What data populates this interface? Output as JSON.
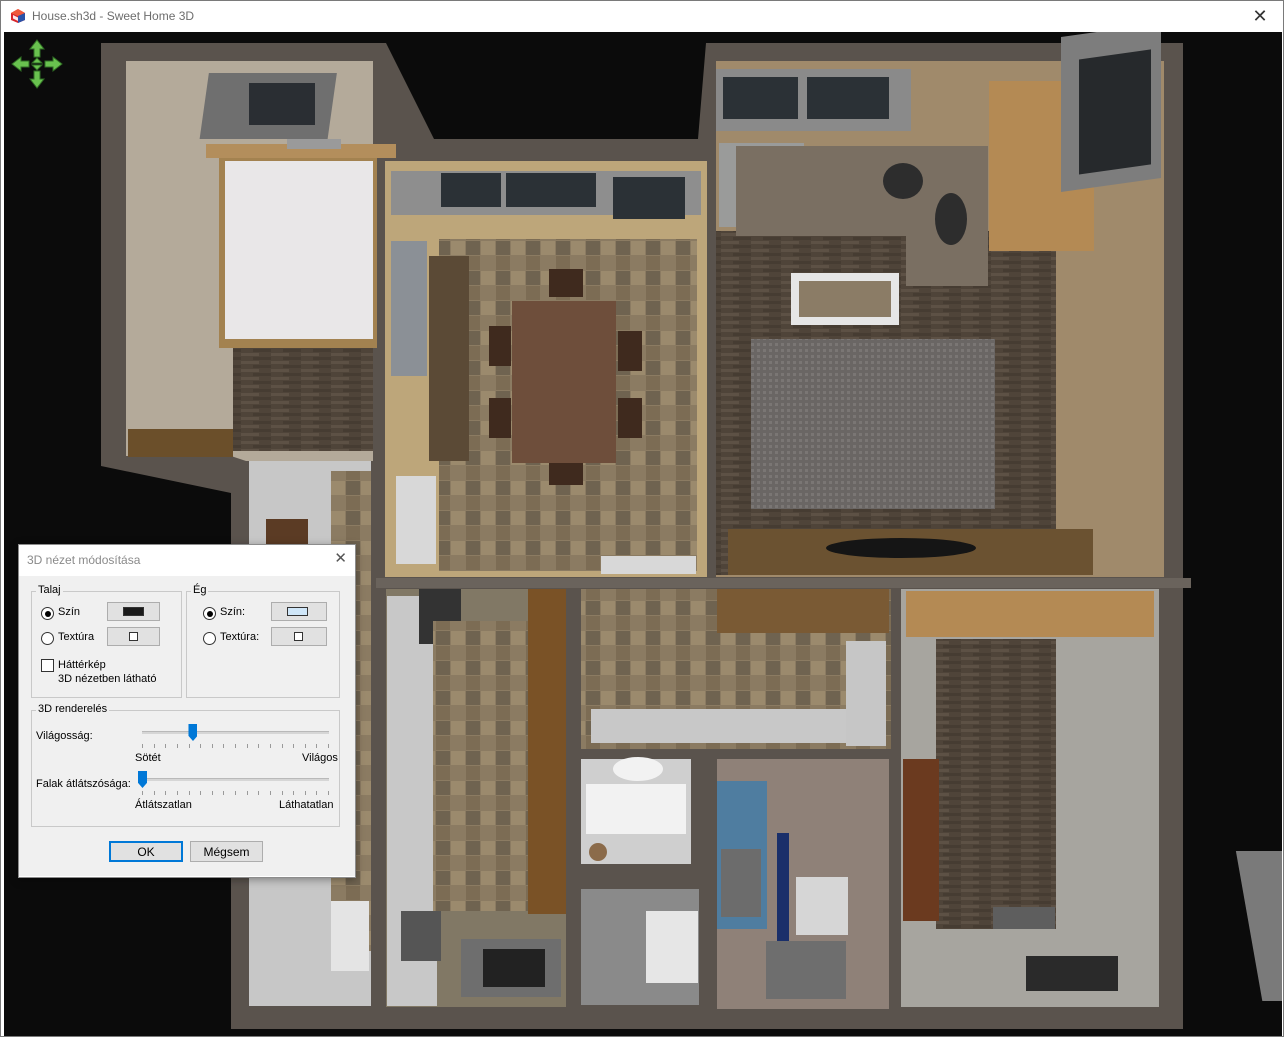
{
  "window": {
    "title": "House.sh3d - Sweet Home 3D",
    "close_glyph": "✕"
  },
  "icons": {
    "app": "sweet-home-3d-app-icon",
    "navigator": "navigation-arrows-icon"
  },
  "dialog": {
    "title": "3D nézet módosítása",
    "close_glyph": "✕",
    "ground": {
      "label": "Talaj",
      "color_label": "Szín",
      "texture_label": "Textúra",
      "color": "#1a1a1a",
      "selected": "color",
      "bg_checkbox_label": "Háttérkép",
      "bg_checkbox_sublabel": "3D nézetben látható",
      "bg_checked": false
    },
    "sky": {
      "label": "Ég",
      "color_label": "Szín:",
      "texture_label": "Textúra:",
      "color": "#cfe6f8",
      "selected": "color"
    },
    "rendering": {
      "label": "3D renderelés",
      "brightness_label": "Világosság:",
      "brightness_min_label": "Sötét",
      "brightness_max_label": "Világos",
      "brightness_value": 0.27,
      "transparency_label": "Falak átlátszósága:",
      "transparency_min_label": "Átlátszatlan",
      "transparency_max_label": "Láthatatlan",
      "transparency_value": 0.0
    },
    "ok_label": "OK",
    "cancel_label": "Mégsem"
  }
}
